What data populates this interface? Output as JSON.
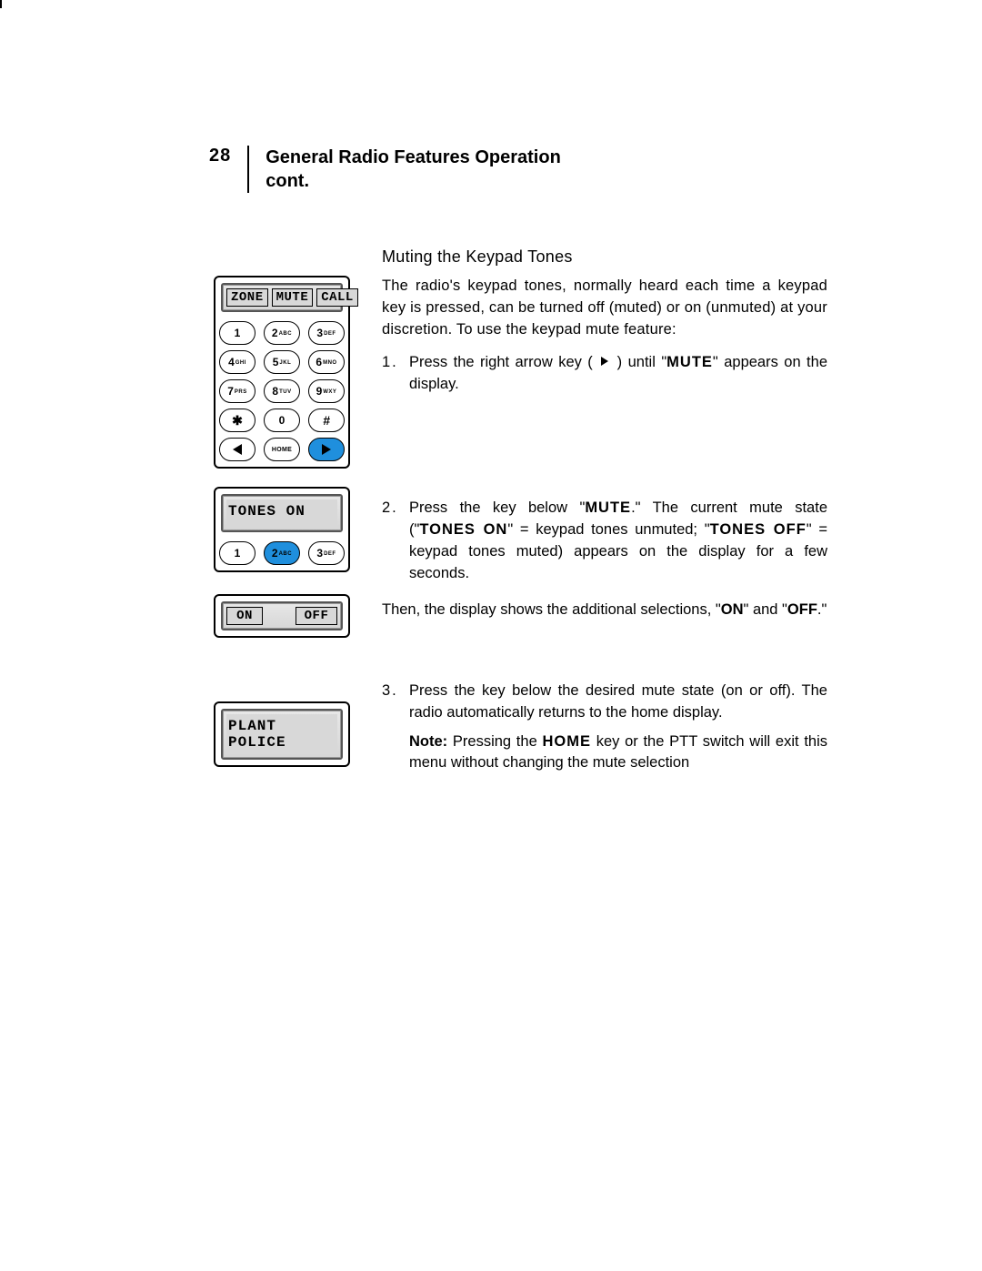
{
  "header": {
    "page_number": "28",
    "title_line1": "General Radio Features Operation",
    "title_line2": "cont."
  },
  "section": {
    "subtitle": "Muting the Keypad Tones",
    "intro": "The radio's keypad tones, normally heard each time a keypad key is pressed, can be turned off (muted) or on (unmuted) at your discretion. To use the keypad mute feature:",
    "step1": {
      "num": "1.",
      "pre": "Press the right arrow key ( ",
      "post": " ) until \"",
      "kw": "MUTE",
      "tail": "\" appears on the display."
    },
    "step2": {
      "num": "2.",
      "t1": "Press the key below \"",
      "kw1": "MUTE",
      "t2": ".\" The current mute state (\"",
      "kw2": "TONES ON",
      "t3": "\" = keypad tones unmuted; \"",
      "kw3": "TONES OFF",
      "t4": "\" = keypad tones muted) appears on the display for a few seconds."
    },
    "then_text_a": "Then, the display shows the additional selections, \"",
    "then_on": "ON",
    "then_mid": "\" and \"",
    "then_off": "OFF",
    "then_tail": ".\"",
    "step3": {
      "num": "3.",
      "text": "Press the key below the desired mute state (on or off). The radio automatically returns to the home display."
    },
    "note_label": "Note:",
    "note_a": " Pressing the ",
    "note_home": "HOME",
    "note_b": " key or the PTT switch will exit this menu without changing the mute selection"
  },
  "device1": {
    "lcd": {
      "a": "ZONE",
      "b": "MUTE",
      "c": "CALL"
    },
    "keys": {
      "k1": "1",
      "k2n": "2",
      "k2s": "ABC",
      "k3n": "3",
      "k3s": "DEF",
      "k4n": "4",
      "k4s": "GHI",
      "k5n": "5",
      "k5s": "JKL",
      "k6n": "6",
      "k6s": "MNO",
      "k7n": "7",
      "k7s": "PRS",
      "k8n": "8",
      "k8s": "TUV",
      "k9n": "9",
      "k9s": "WXY",
      "k0": "0",
      "home": "HOME"
    }
  },
  "device2": {
    "lcd_text": "TONES ON",
    "keys": {
      "k1": "1",
      "k2n": "2",
      "k2s": "ABC",
      "k3n": "3",
      "k3s": "DEF"
    }
  },
  "device3": {
    "lcd": {
      "a": "ON",
      "b": "OFF"
    }
  },
  "device4": {
    "lcd_text": "PLANT POLICE"
  }
}
